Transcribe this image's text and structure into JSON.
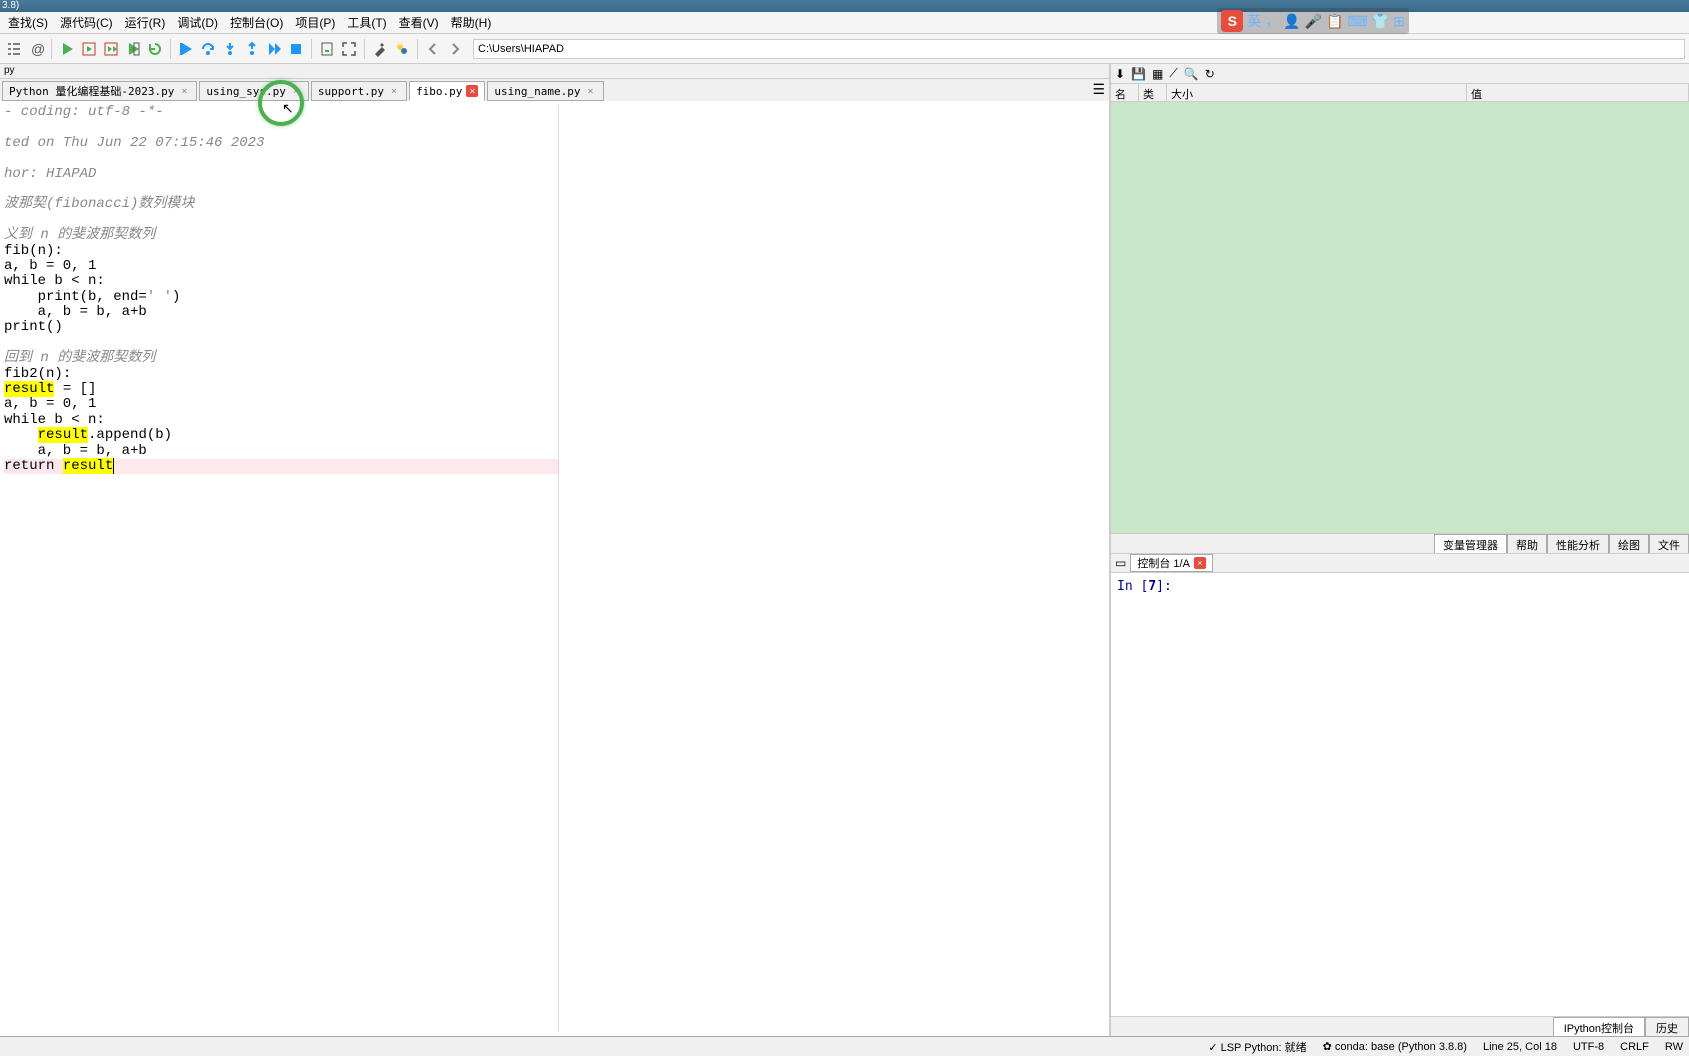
{
  "titlebar": "3.8)",
  "menu": [
    "查找(S)",
    "源代码(C)",
    "运行(R)",
    "调试(D)",
    "控制台(O)",
    "项目(P)",
    "工具(T)",
    "查看(V)",
    "帮助(H)"
  ],
  "path": "C:\\Users\\HIAPAD",
  "filetab": "py",
  "tabs": [
    {
      "label": "Python 量化编程基础-2023.py",
      "modified": false,
      "active": false
    },
    {
      "label": "using_sys.py",
      "modified": false,
      "active": false
    },
    {
      "label": "support.py",
      "modified": false,
      "active": false
    },
    {
      "label": "fibo.py",
      "modified": true,
      "active": true
    },
    {
      "label": "using_name.py",
      "modified": false,
      "active": false
    }
  ],
  "code": {
    "l1": "- coding: utf-8 -*-",
    "l2": "ted on Thu Jun 22 07:15:46 2023",
    "l3": "hor: HIAPAD",
    "l4": "波那契(fibonacci)数列模块",
    "l5": "义到 n 的斐波那契数列",
    "l6a": "fib",
    "l6b": "(n):",
    "l7": "a, b = 0, 1",
    "l8": "while b < n:",
    "l9a": "    print(b, end=",
    "l9b": "' '",
    "l9c": ")",
    "l10": "    a, b = b, a+b",
    "l11": "print()",
    "l12": "回到 n 的斐波那契数列",
    "l13a": "fib2",
    "l13b": "(n):",
    "l14a": "result",
    "l14b": " = []",
    "l15": "a, b = 0, 1",
    "l16": "while b < n:",
    "l17a": "    ",
    "l17b": "result",
    "l17c": ".append(b)",
    "l18": "    a, b = b, a+b",
    "l19a": "return ",
    "l19b": "result"
  },
  "varheaders": {
    "name": "名称",
    "type": "类型",
    "size": "大小",
    "value": "值"
  },
  "vartabs": [
    "变量管理器",
    "帮助",
    "性能分析",
    "绘图",
    "文件"
  ],
  "consoletab": "控制台 1/A",
  "consoleprompt": "In [",
  "consolenum": "7",
  "consolesuffix": "]: ",
  "bottomtabs": [
    "IPython控制台",
    "历史"
  ],
  "status": {
    "lsp": "✓ LSP Python: 就绪",
    "conda": "✿ conda: base (Python 3.8.8)",
    "pos": "Line 25, Col 18",
    "enc": "UTF-8",
    "eol": "CRLF",
    "rw": "RW"
  },
  "ime": {
    "logo": "S",
    "lang": "英",
    "punct": "，",
    "icons": [
      "👤",
      "🎤",
      "📋",
      "⌨",
      "👕",
      "⊞"
    ]
  }
}
